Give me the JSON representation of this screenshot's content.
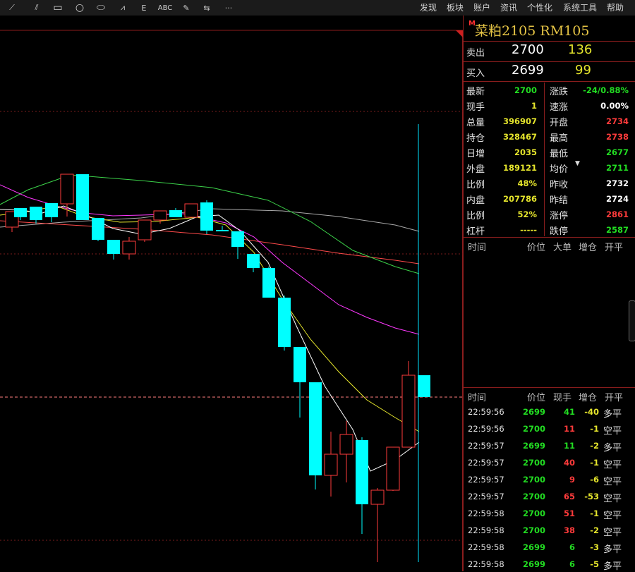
{
  "toolbar": {
    "tools": [
      {
        "name": "line-tool-icon",
        "glyph": "⟋"
      },
      {
        "name": "parallel-lines-tool-icon",
        "glyph": "⫽"
      },
      {
        "name": "rectangle-tool-icon",
        "glyph": "▭"
      },
      {
        "name": "circle-tool-icon",
        "glyph": "○"
      },
      {
        "name": "ellipse-tool-icon",
        "glyph": "⬭"
      },
      {
        "name": "fan-lines-tool-icon",
        "glyph": "⩘"
      },
      {
        "name": "fibonacci-tool-icon",
        "glyph": "Ε"
      },
      {
        "name": "text-tool",
        "glyph": "ABC"
      },
      {
        "name": "pen-tool-icon",
        "glyph": "✎"
      },
      {
        "name": "arrow-tool-icon",
        "glyph": "⇆"
      },
      {
        "name": "more-tools-icon",
        "glyph": "···"
      }
    ],
    "menu": [
      "发现",
      "板块",
      "账户",
      "资讯",
      "个性化",
      "系统工具",
      "帮助"
    ]
  },
  "symbol": {
    "badge": "M",
    "title": "菜粕2105  RM105"
  },
  "quote": {
    "sell_label": "卖出",
    "sell_price": "2700",
    "sell_vol": "136",
    "buy_label": "买入",
    "buy_price": "2699",
    "buy_vol": "99"
  },
  "stats_left": [
    {
      "label": "最新",
      "value": "2700",
      "color": "#22dd22"
    },
    {
      "label": "现手",
      "value": "1",
      "color": "#e5e52c"
    },
    {
      "label": "总量",
      "value": "396907",
      "color": "#e5e52c"
    },
    {
      "label": "持仓",
      "value": "328467",
      "color": "#e5e52c"
    },
    {
      "label": "日增",
      "value": "2035",
      "color": "#e5e52c"
    },
    {
      "label": "外盘",
      "value": "189121",
      "color": "#e5e52c"
    },
    {
      "label": "比例",
      "value": "48%",
      "color": "#e5e52c"
    },
    {
      "label": "内盘",
      "value": "207786",
      "color": "#e5e52c"
    },
    {
      "label": "比例",
      "value": "52%",
      "color": "#e5e52c"
    },
    {
      "label": "杠杆",
      "value": "-----",
      "color": "#e5e52c"
    }
  ],
  "stats_right": [
    {
      "label": "涨跌",
      "value": "-24/0.88%",
      "color": "#22dd22"
    },
    {
      "label": "速涨",
      "value": "0.00%",
      "color": "#ffffff"
    },
    {
      "label": "开盘",
      "value": "2734",
      "color": "#ff3b3b"
    },
    {
      "label": "最高",
      "value": "2738",
      "color": "#ff3b3b"
    },
    {
      "label": "最低",
      "value": "2677",
      "color": "#22dd22"
    },
    {
      "label": "均价",
      "value": "2711",
      "color": "#22dd22"
    },
    {
      "label": "昨收",
      "value": "2732",
      "color": "#ffffff"
    },
    {
      "label": "昨结",
      "value": "2724",
      "color": "#ffffff"
    },
    {
      "label": "涨停",
      "value": "2861",
      "color": "#ff3b3b"
    },
    {
      "label": "跌停",
      "value": "2587",
      "color": "#22dd22"
    }
  ],
  "big_orders_header": [
    "时间",
    "价位",
    "大单",
    "增仓",
    "开平"
  ],
  "ticks_header": [
    "时间",
    "价位",
    "现手",
    "增仓",
    "开平"
  ],
  "ticks": [
    {
      "time": "22:59:56",
      "price": "2699",
      "pc": "#22dd22",
      "vol": "41",
      "vc": "#22dd22",
      "chg": "-40",
      "open": "多平"
    },
    {
      "time": "22:59:56",
      "price": "2700",
      "pc": "#22dd22",
      "vol": "11",
      "vc": "#ff3b3b",
      "chg": "-1",
      "open": "空平"
    },
    {
      "time": "22:59:57",
      "price": "2699",
      "pc": "#22dd22",
      "vol": "11",
      "vc": "#22dd22",
      "chg": "-2",
      "open": "多平"
    },
    {
      "time": "22:59:57",
      "price": "2700",
      "pc": "#22dd22",
      "vol": "40",
      "vc": "#ff3b3b",
      "chg": "-1",
      "open": "空平"
    },
    {
      "time": "22:59:57",
      "price": "2700",
      "pc": "#22dd22",
      "vol": "9",
      "vc": "#ff3b3b",
      "chg": "-6",
      "open": "空平"
    },
    {
      "time": "22:59:57",
      "price": "2700",
      "pc": "#22dd22",
      "vol": "65",
      "vc": "#ff3b3b",
      "chg": "-53",
      "open": "空平"
    },
    {
      "time": "22:59:58",
      "price": "2700",
      "pc": "#22dd22",
      "vol": "51",
      "vc": "#ff3b3b",
      "chg": "-1",
      "open": "空平"
    },
    {
      "time": "22:59:58",
      "price": "2700",
      "pc": "#22dd22",
      "vol": "38",
      "vc": "#ff3b3b",
      "chg": "-2",
      "open": "空平"
    },
    {
      "time": "22:59:58",
      "price": "2699",
      "pc": "#22dd22",
      "vol": "6",
      "vc": "#22dd22",
      "chg": "-3",
      "open": "多平"
    },
    {
      "time": "22:59:58",
      "price": "2699",
      "pc": "#22dd22",
      "vol": "6",
      "vc": "#22dd22",
      "chg": "-5",
      "open": "多平"
    }
  ],
  "colors": {
    "up": "#ff3b3b",
    "down": "#00ffff",
    "border": "#8a1d1d",
    "accent": "#e5c445"
  }
}
